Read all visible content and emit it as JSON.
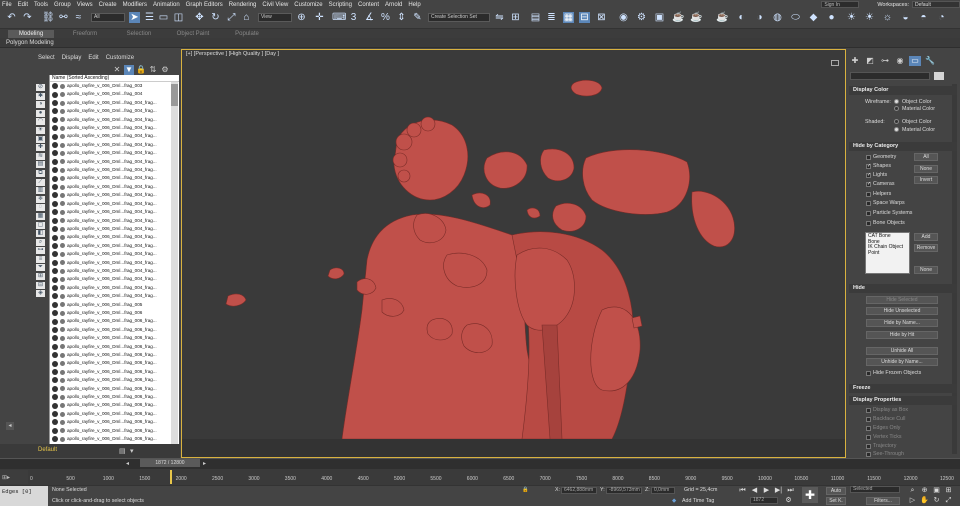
{
  "menu": {
    "items": [
      "File",
      "Edit",
      "Tools",
      "Group",
      "Views",
      "Create",
      "Modifiers",
      "Animation",
      "Graph Editors",
      "Rendering",
      "Civil View",
      "Customize",
      "Scripting",
      "Content",
      "Arnold",
      "Help"
    ],
    "workspaces_label": "Workspaces:",
    "workspace_value": "Default",
    "sign_in": "Sign In"
  },
  "toolbar": {
    "selection_filter": "All",
    "ref_coord": "View",
    "named_selection": "Create Selection Set"
  },
  "ribbon": {
    "tabs": [
      "Modeling",
      "Freeform",
      "Selection",
      "Object Paint",
      "Populate"
    ],
    "active_tab": "Modeling",
    "sub_label": "Polygon Modeling"
  },
  "explorer": {
    "menu": [
      "Select",
      "Display",
      "Edit",
      "Customize"
    ],
    "header": "Name (Sorted Ascending)",
    "rows": [
      "apollo_rayfire_v_006_Dml...frag_003",
      "apollo_rayfire_v_006_Dml...frag_004",
      "apollo_rayfire_v_006_Dml...frag_004_frag...",
      "apollo_rayfire_v_006_Dml...frag_004_frag...",
      "apollo_rayfire_v_006_Dml...frag_004_frag...",
      "apollo_rayfire_v_006_Dml...frag_004_frag...",
      "apollo_rayfire_v_006_Dml...frag_004_frag...",
      "apollo_rayfire_v_006_Dml...frag_004_frag...",
      "apollo_rayfire_v_006_Dml...frag_004_frag...",
      "apollo_rayfire_v_006_Dml...frag_004_frag...",
      "apollo_rayfire_v_006_Dml...frag_004_frag...",
      "apollo_rayfire_v_006_Dml...frag_004_frag...",
      "apollo_rayfire_v_006_Dml...frag_004_frag...",
      "apollo_rayfire_v_006_Dml...frag_004_frag...",
      "apollo_rayfire_v_006_Dml...frag_004_frag...",
      "apollo_rayfire_v_006_Dml...frag_004_frag...",
      "apollo_rayfire_v_006_Dml...frag_004_frag...",
      "apollo_rayfire_v_006_Dml...frag_004_frag...",
      "apollo_rayfire_v_006_Dml...frag_004_frag...",
      "apollo_rayfire_v_006_Dml...frag_004_frag...",
      "apollo_rayfire_v_006_Dml...frag_004_frag...",
      "apollo_rayfire_v_006_Dml...frag_004_frag...",
      "apollo_rayfire_v_006_Dml...frag_004_frag...",
      "apollo_rayfire_v_006_Dml...frag_004_frag...",
      "apollo_rayfire_v_006_Dml...frag_004_frag...",
      "apollo_rayfire_v_006_Dml...frag_004_frag...",
      "apollo_rayfire_v_006_Dml...frag_005",
      "apollo_rayfire_v_006_Dml...frag_006",
      "apollo_rayfire_v_006_Dml...frag_006_frag...",
      "apollo_rayfire_v_006_Dml...frag_006_frag...",
      "apollo_rayfire_v_006_Dml...frag_006_frag...",
      "apollo_rayfire_v_006_Dml...frag_006_frag...",
      "apollo_rayfire_v_006_Dml...frag_006_frag...",
      "apollo_rayfire_v_006_Dml...frag_006_frag...",
      "apollo_rayfire_v_006_Dml...frag_006_frag...",
      "apollo_rayfire_v_006_Dml...frag_006_frag...",
      "apollo_rayfire_v_006_Dml...frag_006_frag...",
      "apollo_rayfire_v_006_Dml...frag_006_frag...",
      "apollo_rayfire_v_006_Dml...frag_006_frag...",
      "apollo_rayfire_v_006_Dml...frag_006_frag...",
      "apollo_rayfire_v_006_Dml...frag_006_frag...",
      "apollo_rayfire_v_006_Dml...frag_006_frag...",
      "apollo_rayfire_v_006_Dml...frag_006_frag...",
      "apollo_rayfire_v_006_Dml...frag_006_frag...",
      "apollo_rayfire_v_006_Dml...frag_006_frag...",
      "apollo_rayfire_v_006_Dml...frag_006_frag...",
      "apollo_rayfire_v_006_Dml...frag_006_frag..."
    ],
    "layer": "Default"
  },
  "viewport": {
    "label": "[+] [Perspective ] [High Quality ] [Day ]",
    "model_color": "#c0504a"
  },
  "command_panel": {
    "display_color": {
      "title": "Display Color",
      "wireframe_label": "Wireframe:",
      "shaded_label": "Shaded:",
      "opt_object_color": "Object Color",
      "opt_material_color": "Material Color"
    },
    "hide_by_category": {
      "title": "Hide by Category",
      "items": [
        "Geometry",
        "Shapes",
        "Lights",
        "Cameras",
        "Helpers",
        "Space Warps",
        "Particle Systems",
        "Bone Objects"
      ],
      "btn_all": "All",
      "btn_none": "None",
      "btn_invert": "Invert",
      "list": [
        "CAT Bone",
        "Bone",
        "IK Chain Object",
        "Point"
      ],
      "btn_add": "Add",
      "btn_remove": "Remove",
      "btn_none2": "None"
    },
    "hide": {
      "title": "Hide",
      "buttons": [
        "Hide Selected",
        "Hide Unselected",
        "Hide by Name...",
        "Hide by Hit",
        "Unhide All",
        "Unhide by Name..."
      ],
      "frozen": "Hide Frozen Objects"
    },
    "freeze_title": "Freeze",
    "display_properties": {
      "title": "Display Properties",
      "items": [
        "Display as Box",
        "Backface Cull",
        "Edges Only",
        "Vertex Ticks",
        "Trajectory",
        "See-Through"
      ]
    }
  },
  "timeline": {
    "frame_slider": "1872 / 12800",
    "ticks": [
      "0",
      "500",
      "1000",
      "1500",
      "2000",
      "2500",
      "3000",
      "3500",
      "4000",
      "4500",
      "5000",
      "5500",
      "6000",
      "6500",
      "7000",
      "7500",
      "8000",
      "8500",
      "9000",
      "9500",
      "10000",
      "10500",
      "11000",
      "11500",
      "12000",
      "12500"
    ]
  },
  "status": {
    "maxscript": "Edges [0]",
    "selection": "None Selected",
    "prompt": "Click or click-and-drag to select objects",
    "x_label": "X:",
    "y_label": "Y:",
    "z_label": "Z:",
    "x_value": "6462,888mm",
    "y_value": "-8969,573mm",
    "z_value": "0,0mm",
    "grid": "Grid = 25,4cm",
    "add_time_tag": "Add Time Tag",
    "current_frame": "1872",
    "auto": "Auto",
    "set_key": "Set K.",
    "selected_dropdown": "Selected",
    "filters": "Filters..."
  }
}
